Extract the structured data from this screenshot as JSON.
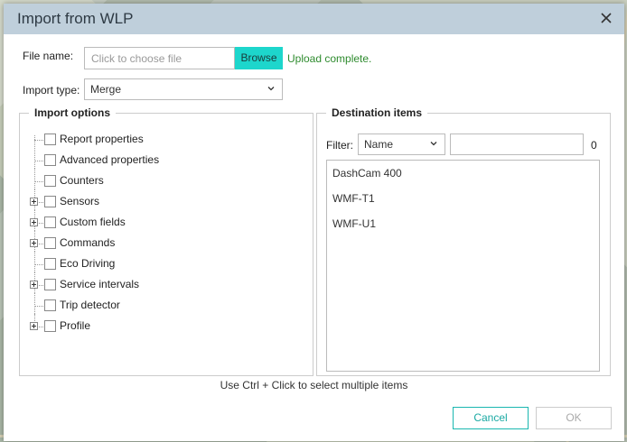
{
  "dialog": {
    "title": "Import from WLP",
    "file_name_label": "File name:",
    "file_placeholder": "Click to choose file",
    "browse_label": "Browse",
    "upload_status": "Upload complete.",
    "import_type_label": "Import type:",
    "import_type_value": "Merge"
  },
  "import_options": {
    "legend": "Import options",
    "items": [
      {
        "label": "Report properties",
        "expandable": false
      },
      {
        "label": "Advanced properties",
        "expandable": false
      },
      {
        "label": "Counters",
        "expandable": false
      },
      {
        "label": "Sensors",
        "expandable": true
      },
      {
        "label": "Custom fields",
        "expandable": true
      },
      {
        "label": "Commands",
        "expandable": true
      },
      {
        "label": "Eco Driving",
        "expandable": false
      },
      {
        "label": "Service intervals",
        "expandable": true
      },
      {
        "label": "Trip detector",
        "expandable": false
      },
      {
        "label": "Profile",
        "expandable": true
      }
    ]
  },
  "destination": {
    "legend": "Destination items",
    "filter_label": "Filter:",
    "filter_field": "Name",
    "filter_value": "",
    "count": "0",
    "items": [
      "DashCam 400",
      "WMF-T1",
      "WMF-U1"
    ]
  },
  "hint": "Use Ctrl + Click to select multiple items",
  "buttons": {
    "cancel": "Cancel",
    "ok": "OK"
  },
  "colors": {
    "accent": "#1dd6cc",
    "titlebar": "#bfcfdb",
    "success": "#2e8b2e"
  }
}
